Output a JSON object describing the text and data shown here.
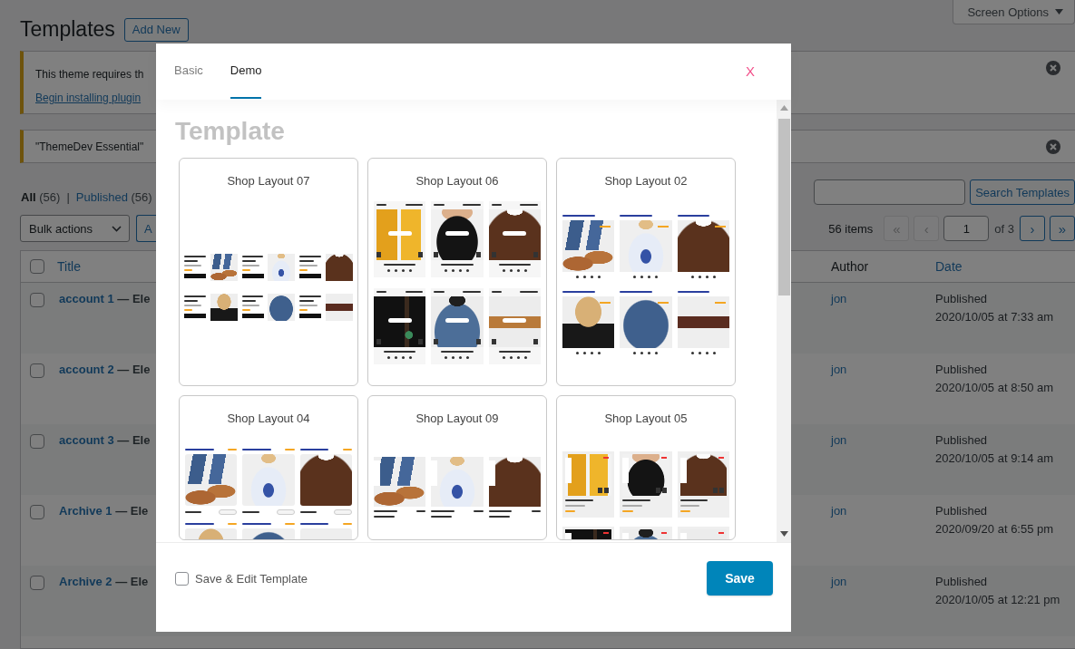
{
  "page": {
    "title": "Templates",
    "add_new": "Add New",
    "screen_options": "Screen Options"
  },
  "notices": [
    {
      "lines": [
        {
          "kind": "text",
          "text": "This theme requires th"
        },
        {
          "kind": "link",
          "text": "Begin installing plugin"
        }
      ]
    },
    {
      "lines": [
        {
          "kind": "text",
          "text": "\"ThemeDev Essential\""
        }
      ]
    }
  ],
  "views": {
    "separator": "|",
    "items": [
      {
        "label": "All",
        "count": "(56)",
        "selected": true
      },
      {
        "label": "Published",
        "count": "(56)",
        "selected": false
      }
    ]
  },
  "search": {
    "button": "Search Templates"
  },
  "bulk_actions": {
    "value": "Bulk actions",
    "apply": "A"
  },
  "pagination": {
    "count": "56 items",
    "back": [
      {
        "label": "«",
        "disabled": true
      },
      {
        "label": "‹",
        "disabled": true
      }
    ],
    "page": "1",
    "total": "of 3",
    "forward": [
      {
        "label": "›",
        "disabled": false
      },
      {
        "label": "»",
        "disabled": false
      }
    ]
  },
  "table": {
    "select_all_checked": false,
    "columns": [
      {
        "label": "Title",
        "sortable": true
      },
      {
        "label": "Author",
        "sortable": false
      },
      {
        "label": "Date",
        "sortable": true
      }
    ],
    "rows": [
      {
        "checked": false,
        "title": "account 1",
        "title_rest": "— Ele",
        "author": "jon",
        "status": "Published",
        "date": "2020/10/05 at 7:33 am"
      },
      {
        "checked": false,
        "title": "account 2",
        "title_rest": "— Ele",
        "author": "jon",
        "status": "Published",
        "date": "2020/10/05 at 8:50 am"
      },
      {
        "checked": false,
        "title": "account 3",
        "title_rest": "— Ele",
        "author": "jon",
        "status": "Published",
        "date": "2020/10/05 at 9:14 am"
      },
      {
        "checked": false,
        "title": "Archive 1",
        "title_rest": "— Ele",
        "author": "jon",
        "status": "Published",
        "date": "2020/09/20 at 6:55 pm"
      },
      {
        "checked": false,
        "title": "Archive 2",
        "title_rest": "— Ele",
        "author": "jon",
        "status": "Published",
        "date": "2020/10/05 at 12:21 pm"
      }
    ]
  },
  "modal": {
    "tabs": [
      {
        "label": "Basic",
        "selected": false
      },
      {
        "label": "Demo",
        "selected": true
      }
    ],
    "close": "X",
    "heading": "Template",
    "templates": [
      {
        "title": "Shop Layout 07",
        "kind": "list"
      },
      {
        "title": "Shop Layout 06",
        "kind": "overlay"
      },
      {
        "title": "Shop Layout 02",
        "kind": "titled"
      },
      {
        "title": "Shop Layout 04",
        "kind": "buttons"
      },
      {
        "title": "Shop Layout 09",
        "kind": "side"
      },
      {
        "title": "Shop Layout 05",
        "kind": "cards"
      }
    ],
    "save_and_edit": {
      "label": "Save & Edit Template",
      "checked": false
    },
    "save": "Save"
  }
}
